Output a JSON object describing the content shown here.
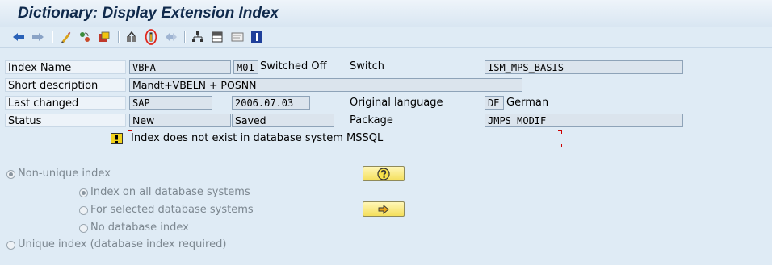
{
  "window": {
    "title": "Dictionary: Display Extension Index"
  },
  "toolbar": {
    "buttons": [
      {
        "icon": "back-arrow-icon"
      },
      {
        "icon": "forward-arrow-icon"
      },
      {
        "icon": "display-change-icon"
      },
      {
        "icon": "other-object-icon"
      },
      {
        "icon": "check-icon"
      },
      {
        "icon": "where-used-icon"
      },
      {
        "icon": "activate-icon",
        "highlighted": true
      },
      {
        "icon": "navigate-icon"
      },
      {
        "icon": "hierarchy-icon"
      },
      {
        "icon": "table-icon"
      },
      {
        "icon": "layout-icon"
      },
      {
        "icon": "info-icon"
      }
    ]
  },
  "form": {
    "index_name": {
      "label": "Index Name",
      "table": "VBFA",
      "id": "M01",
      "status_text": "Switched Off"
    },
    "switch": {
      "label": "Switch",
      "value": "ISM_MPS_BASIS"
    },
    "short_description": {
      "label": "Short description",
      "value": "Mandt+VBELN + POSNN"
    },
    "last_changed": {
      "label": "Last changed",
      "user": "SAP",
      "date": "2006.07.03"
    },
    "original_language": {
      "label": "Original language",
      "code": "DE",
      "name": "German"
    },
    "status": {
      "label": "Status",
      "value1": "New",
      "value2": "Saved"
    },
    "package": {
      "label": "Package",
      "value": "JMPS_MODIF"
    },
    "message": {
      "text": "Index does not exist in database system MSSQL"
    }
  },
  "options": {
    "non_unique": "Non-unique index",
    "all_db": "Index on all database systems",
    "selected_db": "For selected database systems",
    "no_db": "No database index",
    "unique": "Unique index (database index required)"
  },
  "colors": {
    "background": "#dfebf5",
    "title": "#102a4c",
    "highlight_circle": "#e0261c",
    "button_yellow": "#f4df5c"
  }
}
